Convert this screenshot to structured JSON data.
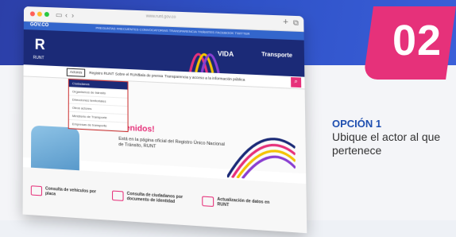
{
  "badge": {
    "number": "02",
    "color": "#e6317a"
  },
  "option": {
    "title": "OPCIÓN 1",
    "description": "Ubique el actor al que pertenece"
  },
  "browser": {
    "url": "www.runt.gov.co",
    "gov_logo": "GOV.CO",
    "gov_links": "PREGUNTAS FRECUENTES   CONVOCATORIAS   TRANSPARENCIA   TRÁMITES   FACEBOOK   TWITTER"
  },
  "header": {
    "logo": "R",
    "logo_text": "RUNT",
    "vida": "VIDA",
    "transporte": "Transporte"
  },
  "nav": {
    "items": [
      "Actores",
      "Registro RUNT",
      "Sobre el RUNT",
      "Sala de prensa",
      "Transparencia y acceso a la información pública"
    ]
  },
  "dropdown": {
    "items": [
      "Ciudadanos",
      "Organismos de tránsito",
      "Direcciones territoriales",
      "Otros actores",
      "Ministerio de Transporte",
      "Empresas de transporte"
    ]
  },
  "hero": {
    "welcome": "...enidos!",
    "text": "Está en la página oficial del Registro Único Nacional de Tránsito, RUNT"
  },
  "cards": [
    {
      "label": "Consulta de vehículos por placa"
    },
    {
      "label": "Consulta de ciudadanos por documento de identidad"
    },
    {
      "label": "Actualización de datos en RUNT"
    }
  ]
}
